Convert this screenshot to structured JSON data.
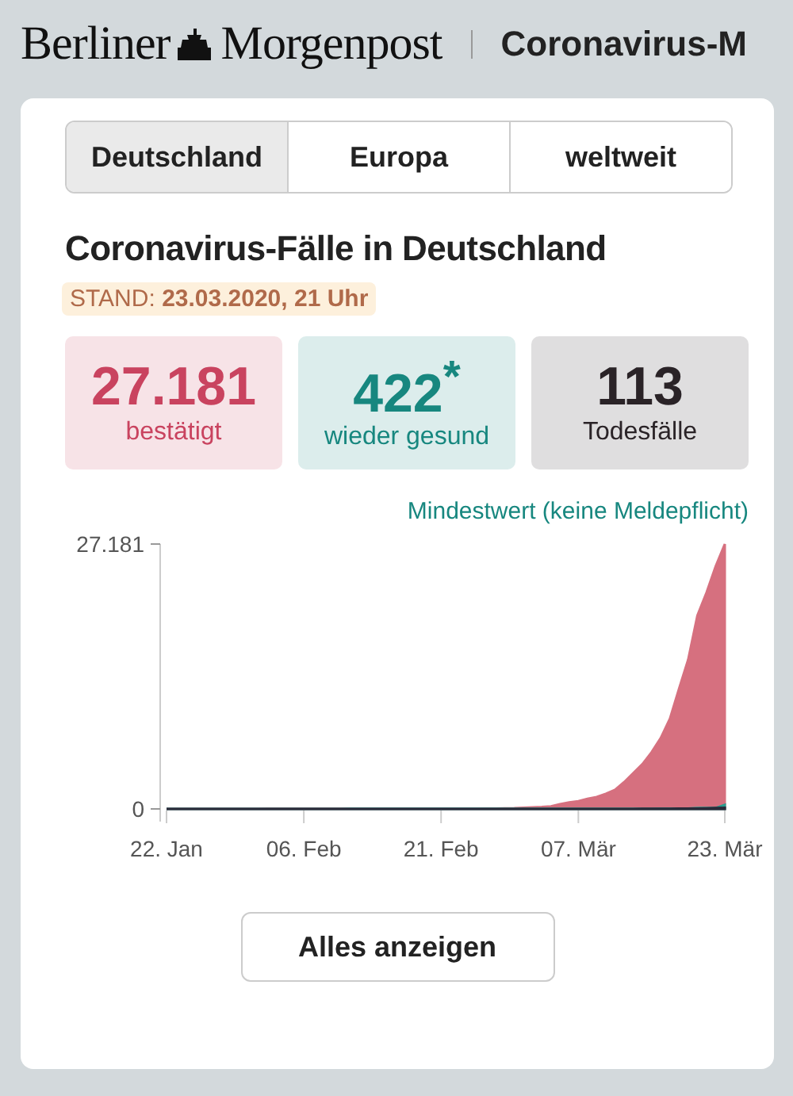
{
  "header": {
    "logo_left": "Berliner",
    "logo_right": "Morgenpost",
    "section_title": "Coronavirus-M"
  },
  "tabs": [
    {
      "label": "Deutschland",
      "selected": true
    },
    {
      "label": "Europa",
      "selected": false
    },
    {
      "label": "weltweit",
      "selected": false
    }
  ],
  "title": "Coronavirus-Fälle in Deutschland",
  "stand": "STAND: **23.03.2020, 21 Uhr**",
  "stats": [
    {
      "value": "27.181",
      "label": "bestätigt",
      "color": "#c9435f"
    },
    {
      "value": "422$^{*}$",
      "label": "wieder gesund",
      "color": "#17877f"
    },
    {
      "value": "113",
      "label": "Todesfälle",
      "color": "#2a2327"
    }
  ],
  "footnote": "Mindestwert (keine Meldepflicht)",
  "chart_data": {
    "type": "area",
    "categories": [
      "22. Jan",
      null,
      null,
      null,
      null,
      null,
      null,
      null,
      null,
      null,
      null,
      null,
      null,
      null,
      null,
      "06. Feb",
      null,
      null,
      null,
      null,
      null,
      null,
      null,
      null,
      null,
      null,
      null,
      null,
      null,
      null,
      "21. Feb",
      null,
      null,
      null,
      null,
      null,
      null,
      null,
      null,
      null,
      null,
      null,
      null,
      null,
      null,
      "07. Mär",
      null,
      null,
      null,
      null,
      null,
      null,
      null,
      null,
      null,
      null,
      null,
      null,
      null,
      null,
      null,
      "23. Mär"
    ],
    "series": [
      {
        "color": "#d6707f",
        "values": [
          0,
          0,
          0,
          0,
          0,
          1,
          4,
          4,
          5,
          7,
          8,
          10,
          12,
          12,
          12,
          12,
          13,
          14,
          14,
          16,
          16,
          16,
          16,
          16,
          16,
          16,
          16,
          16,
          16,
          16,
          16,
          16,
          16,
          16,
          18,
          27,
          46,
          60,
          79,
          130,
          159,
          196,
          262,
          482,
          670,
          800,
          1040,
          1224,
          1565,
          1966,
          2745,
          3675,
          4599,
          5813,
          7272,
          9257,
          12327,
          15320,
          19848,
          22213,
          24873,
          27181
        ]
      },
      {
        "color": "#2a9d8f",
        "values": [
          0,
          0,
          0,
          0,
          0,
          0,
          0,
          0,
          0,
          0,
          0,
          0,
          0,
          0,
          0,
          0,
          0,
          0,
          0,
          0,
          16,
          16,
          16,
          16,
          16,
          16,
          16,
          16,
          16,
          16,
          16,
          16,
          16,
          16,
          16,
          16,
          16,
          16,
          16,
          16,
          16,
          16,
          16,
          16,
          16,
          16,
          16,
          16,
          16,
          16,
          16,
          16,
          16,
          16,
          46,
          46,
          46,
          46,
          100,
          100,
          100,
          422
        ]
      },
      {
        "color": "#2b2b3a",
        "values": [
          0,
          0,
          0,
          0,
          0,
          0,
          0,
          0,
          0,
          0,
          0,
          0,
          0,
          0,
          0,
          0,
          0,
          0,
          0,
          0,
          0,
          0,
          0,
          0,
          0,
          0,
          0,
          0,
          0,
          0,
          0,
          0,
          0,
          0,
          0,
          0,
          0,
          0,
          0,
          0,
          0,
          0,
          0,
          0,
          0,
          0,
          0,
          0,
          2,
          3,
          5,
          7,
          9,
          11,
          13,
          17,
          26,
          31,
          44,
          67,
          94,
          113
        ]
      }
    ],
    "ylim": [
      0,
      27181
    ],
    "yticks": [
      {
        "value": 0,
        "label": "0"
      },
      {
        "value": 27181,
        "label": "27.181"
      }
    ]
  },
  "button": "Alles anzeigen"
}
